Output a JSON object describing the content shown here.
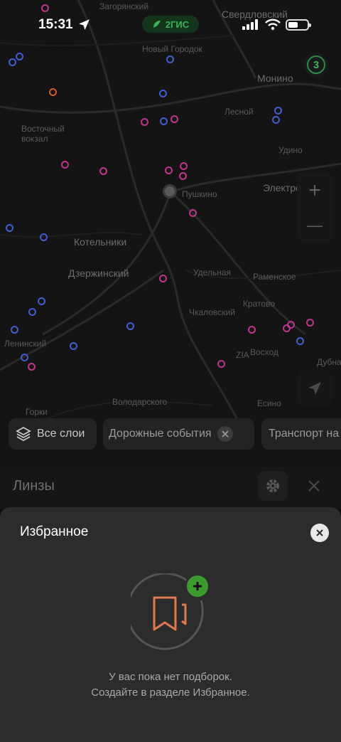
{
  "status_bar": {
    "time": "15:31",
    "icons": [
      "location-arrow-icon",
      "signal-icon",
      "wifi-icon",
      "battery-icon"
    ],
    "brand": "2ГИС",
    "battery_level": 0.5
  },
  "map": {
    "labels": [
      "Загорянский",
      "Свердловский",
      "Новый Городок",
      "Монино",
      "Лесной",
      "Восточный вокзал",
      "Удино",
      "Электро",
      "Пушкино",
      "Котельники",
      "Дзержинский",
      "Кратово",
      "Чкаловский",
      "ZIA",
      "Удельная",
      "Раменское",
      "Восход",
      "Володарского",
      "Дубна",
      "Горки",
      "Ленинский",
      "Есино"
    ],
    "traffic_level": "3",
    "zoom_in": "+",
    "zoom_out": "—"
  },
  "chips": {
    "layers": "Все слои",
    "road_events": "Дорожные события",
    "transport": "Транспорт на"
  },
  "lenses": {
    "title": "Линзы"
  },
  "sheet": {
    "title": "Избранное",
    "empty_line1": "У вас пока нет подборок.",
    "empty_line2": "Создайте в разделе Избранное."
  },
  "colors": {
    "accent_green": "#3a9a2c",
    "illustration_orange": "#e07a4f",
    "poi_blue": "#3f5fd0",
    "poi_magenta": "#c0338f"
  }
}
